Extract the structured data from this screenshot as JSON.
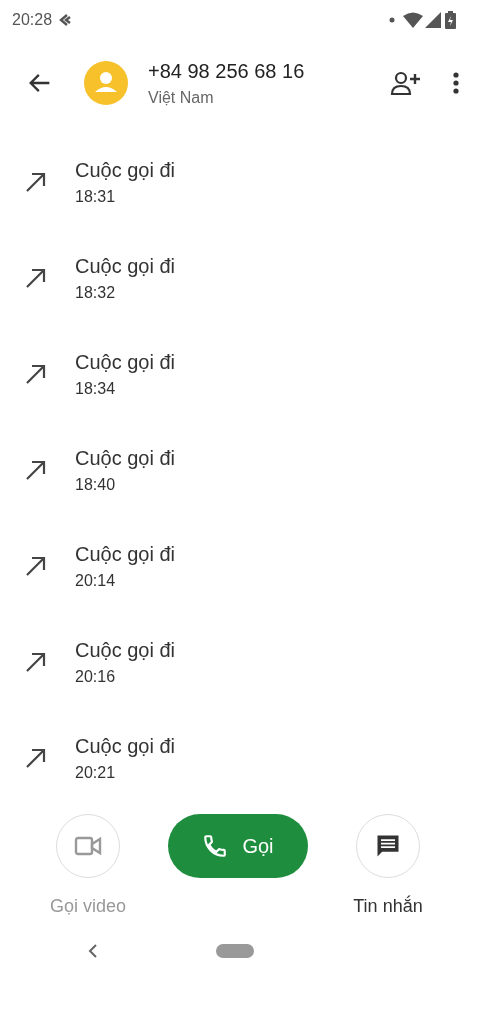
{
  "status_bar": {
    "time": "20:28"
  },
  "header": {
    "title": "+84 98 256 68 16",
    "subtitle": "Việt Nam"
  },
  "calls": [
    {
      "label": "Cuộc gọi đi",
      "time": "18:31"
    },
    {
      "label": "Cuộc gọi đi",
      "time": "18:32"
    },
    {
      "label": "Cuộc gọi đi",
      "time": "18:34"
    },
    {
      "label": "Cuộc gọi đi",
      "time": "18:40"
    },
    {
      "label": "Cuộc gọi đi",
      "time": "20:14"
    },
    {
      "label": "Cuộc gọi đi",
      "time": "20:16"
    },
    {
      "label": "Cuộc gọi đi",
      "time": "20:21"
    }
  ],
  "actions": [
    {
      "kind": "circle",
      "label": "Gọi video",
      "disabled": true
    },
    {
      "kind": "pill",
      "label": "Gọi",
      "disabled": false
    },
    {
      "kind": "circle",
      "label": "Tin nhắn",
      "disabled": false
    }
  ]
}
